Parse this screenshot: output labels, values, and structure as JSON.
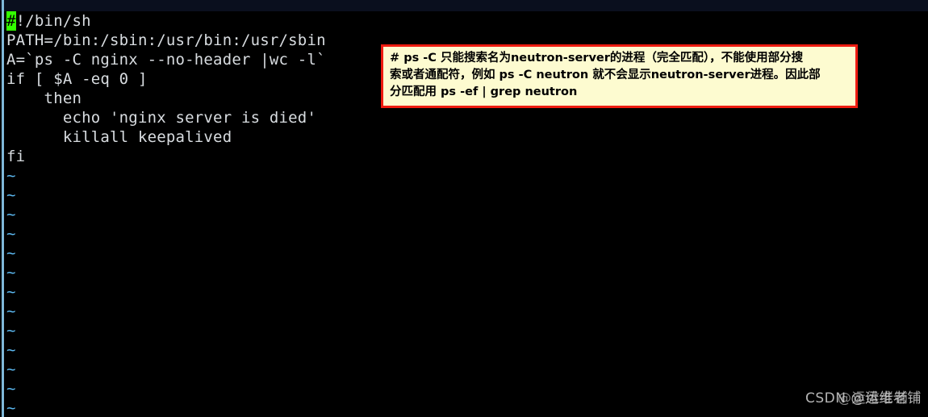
{
  "window": {
    "background_color": "#000000",
    "top_strip_color": "#0a0f1e",
    "left_rule_color": "#7fb8d8"
  },
  "terminal": {
    "text_color": "#d8dce0",
    "tilde_color": "#5bb8f0",
    "cursor_color": "#33ff00",
    "cursor_char": "#",
    "lines": [
      {
        "id": "line-1",
        "text": "!/bin/sh",
        "cursor": "#"
      },
      {
        "id": "line-2",
        "text": "PATH=/bin:/sbin:/usr/bin:/usr/sbin"
      },
      {
        "id": "line-3",
        "text": "A=`ps -C nginx --no-header |wc -l`"
      },
      {
        "id": "line-4",
        "text": "if [ $A -eq 0 ]"
      },
      {
        "id": "line-5",
        "text": "    then"
      },
      {
        "id": "line-6",
        "text": "      echo 'nginx server is died'"
      },
      {
        "id": "line-7",
        "text": "      killall keepalived"
      },
      {
        "id": "line-8",
        "text": "fi"
      }
    ],
    "empty_markers": [
      "~",
      "~",
      "~",
      "~",
      "~",
      "~",
      "~",
      "~",
      "~",
      "~",
      "~",
      "~",
      "~"
    ]
  },
  "annotation": {
    "border_color": "#ee1c11",
    "background_color": "#fdfbd0",
    "text_color": "#000000",
    "lines": [
      "# ps  -C 只能搜索名为neutron-server的进程（完全匹配），不能使用部分搜",
      "索或者通配符，例如 ps -C neutron 就不会显示neutron-server进程。因此部",
      "分匹配用 ps -ef | grep neutron"
    ]
  },
  "watermark": {
    "primary": "CSDN @运维老铺",
    "overlay": "@运维老铺"
  }
}
